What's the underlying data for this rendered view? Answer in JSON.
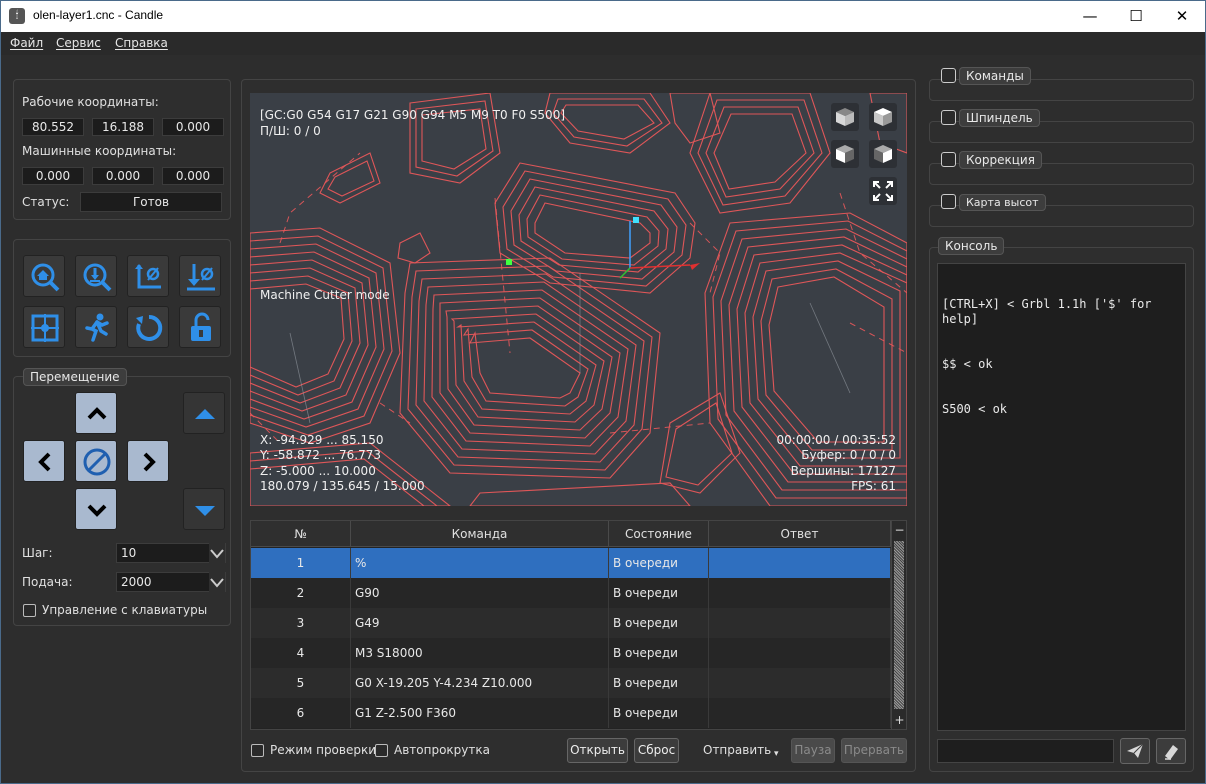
{
  "window": {
    "title": "olen-layer1.cnc - Candle",
    "app_icon": "candle-logo-icon"
  },
  "menu": [
    "Файл",
    "Сервис",
    "Справка"
  ],
  "state": {
    "work_coords_label": "Рабочие координаты:",
    "work_coords": [
      "80.552",
      "16.188",
      "0.000"
    ],
    "machine_coords_label": "Машинные координаты:",
    "machine_coords": [
      "0.000",
      "0.000",
      "0.000"
    ],
    "status_label": "Статус:",
    "status_value": "Готов"
  },
  "control_icons": [
    "home-icon",
    "zero-probe-icon",
    "zero-xy-icon",
    "zero-z-icon",
    "restore-origin-icon",
    "safe-position-icon",
    "soft-reset-icon",
    "unlock-icon"
  ],
  "jog": {
    "title": "Перемещение",
    "step_label": "Шаг:",
    "step_value": "10",
    "feed_label": "Подача:",
    "feed_value": "2000",
    "keyboard_label": "Управление с клавиатуры"
  },
  "visualizer": {
    "gcode_state": "[GC:G0 G54 G17 G21 G90 G94 M5 M9 T0 F0 S500]",
    "spindle_feed": "П/Ш: 0 / 0",
    "mode": "Machine Cutter mode",
    "x_range": "X: -94.929 ... 85.150",
    "y_range": "Y: -58.872 ... 76.773",
    "z_range": "Z: -5.000 ... 10.000",
    "dims": "180.079 / 135.645 / 15.000",
    "time": "00:00:00 / 00:35:52",
    "buffer": "Буфер: 0 / 0 / 0",
    "vertices": "Вершины: 17127",
    "fps": "FPS: 61",
    "path_color": "#e8585a",
    "bg_color": "#3a3f46"
  },
  "table": {
    "headers": [
      "№",
      "Команда",
      "Состояние",
      "Ответ"
    ],
    "rows": [
      {
        "n": "1",
        "cmd": "%",
        "state": "В очереди",
        "resp": ""
      },
      {
        "n": "2",
        "cmd": "G90",
        "state": "В очереди",
        "resp": ""
      },
      {
        "n": "3",
        "cmd": "G49",
        "state": "В очереди",
        "resp": ""
      },
      {
        "n": "4",
        "cmd": "M3 S18000",
        "state": "В очереди",
        "resp": ""
      },
      {
        "n": "5",
        "cmd": "G0 X-19.205 Y-4.234 Z10.000",
        "state": "В очереди",
        "resp": ""
      },
      {
        "n": "6",
        "cmd": "G1   Z-2.500 F360",
        "state": "В очереди",
        "resp": ""
      }
    ],
    "scroll_minus": "−",
    "scroll_plus": "+"
  },
  "bottom": {
    "check_mode": "Режим проверки",
    "autoscroll": "Автопрокрутка",
    "open": "Открыть",
    "reset": "Сброс",
    "send": "Отправить",
    "pause": "Пауза",
    "abort": "Прервать"
  },
  "right": {
    "commands": "Команды",
    "spindle": "Шпиндель",
    "correction": "Коррекция",
    "heightmap": "Карта высот",
    "console_title": "Консоль",
    "console_lines": [
      "[CTRL+X] < Grbl 1.1h ['$' for help]",
      "$$ < ok",
      "S500 < ok"
    ],
    "console_input": ""
  },
  "colors": {
    "accent": "#2f6fbf",
    "icon_blue": "#2f8fe8",
    "jog_light": "#a9b9cf"
  }
}
